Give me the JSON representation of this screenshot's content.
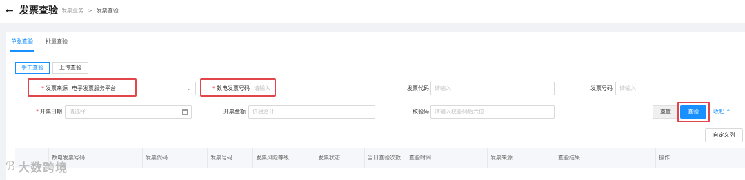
{
  "header": {
    "back_icon": "arrow-left-icon",
    "title": "发票查验",
    "breadcrumb": [
      "发票业务",
      ">",
      "发票查验"
    ]
  },
  "tabs": [
    "单张查验",
    "批量查验"
  ],
  "modes": [
    "手工查验",
    "上传查验"
  ],
  "form": {
    "source_label": "发票来源",
    "source_value": "电子发票服务平台",
    "einvoice_no_label": "数电发票号码",
    "einvoice_no_placeholder": "请输入",
    "code_label": "发票代码",
    "code_placeholder": "请输入",
    "number_label": "发票号码",
    "number_placeholder": "请输入",
    "date_label": "开票日期",
    "date_placeholder": "请选择",
    "amount_label": "开票金额",
    "amount_placeholder": "价税合计",
    "check_code_label": "校验码",
    "check_code_placeholder": "请输入校验码后六位",
    "required_mark": "*"
  },
  "actions": {
    "reset": "重置",
    "query": "查验",
    "collapse": "收起",
    "custom_columns": "自定义列"
  },
  "table": {
    "columns": [
      "数电发票号码",
      "发票代码",
      "发票号码",
      "发票风险等级",
      "发票状态",
      "当日查验次数",
      "查验时间",
      "发票来源",
      "查验结果",
      "操作"
    ]
  },
  "watermark": "大数跨境",
  "colors": {
    "accent": "#1890ff",
    "highlight": "#e0464a"
  }
}
